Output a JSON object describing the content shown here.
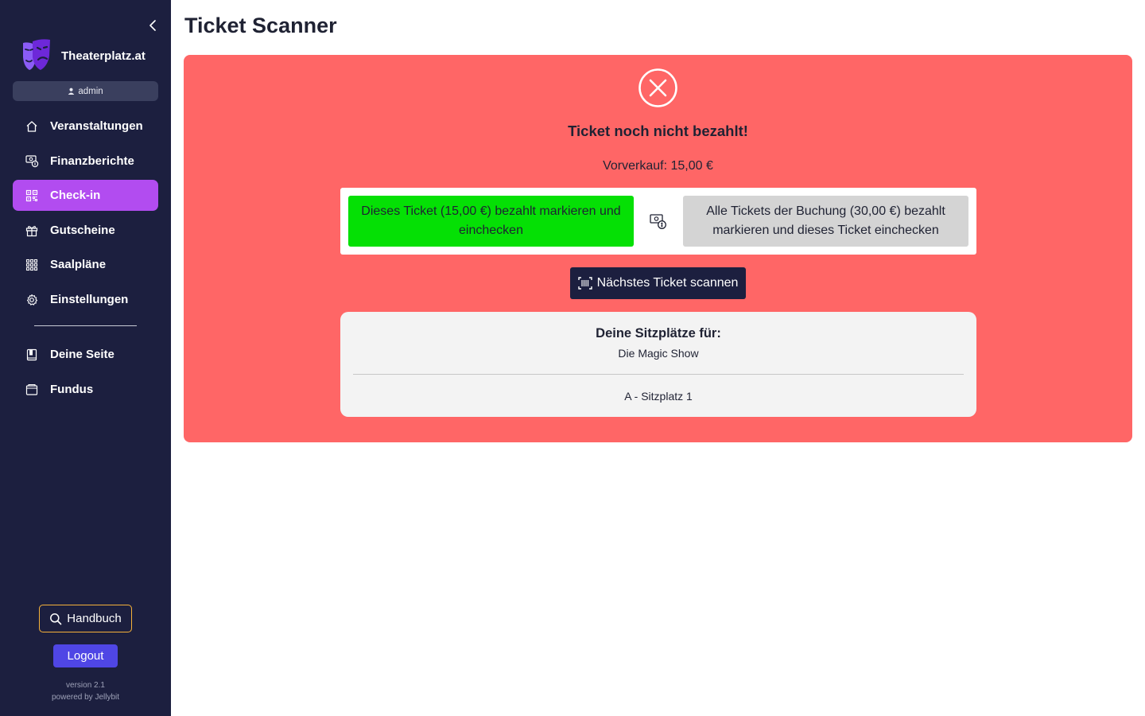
{
  "brand": {
    "name": "Theaterplatz.at"
  },
  "user": {
    "name": "admin"
  },
  "sidebar": {
    "items": [
      {
        "label": "Veranstaltungen",
        "icon": "home-icon",
        "active": false
      },
      {
        "label": "Finanzberichte",
        "icon": "money-icon",
        "active": false
      },
      {
        "label": "Check-in",
        "icon": "qr-code-icon",
        "active": true
      },
      {
        "label": "Gutscheine",
        "icon": "gift-icon",
        "active": false
      },
      {
        "label": "Saalpläne",
        "icon": "grid-icon",
        "active": false
      },
      {
        "label": "Einstellungen",
        "icon": "gear-icon",
        "active": false
      },
      {
        "label": "Deine Seite",
        "icon": "book-icon",
        "active": false
      },
      {
        "label": "Fundus",
        "icon": "box-icon",
        "active": false
      }
    ],
    "handbuch_label": "Handbuch",
    "logout_label": "Logout",
    "version": "version 2.1",
    "powered_by": "powered by Jellybit"
  },
  "main": {
    "title": "Ticket Scanner",
    "status": "Ticket noch nicht bezahlt!",
    "price": "Vorverkauf: 15,00 €",
    "pay_this_label": "Dieses Ticket (15,00 €) bezahlt markieren und einchecken",
    "pay_all_label": "Alle Tickets der Buchung (30,00 €) bezahlt markieren und dieses Ticket einchecken",
    "scan_next_label": "Nächstes Ticket scannen",
    "seats": {
      "title": "Deine Sitzplätze für:",
      "event": "Die Magic Show",
      "seat": "A - Sitzplatz 1"
    }
  },
  "colors": {
    "sidebar_bg": "#1c1f3f",
    "active_item": "#b24cf0",
    "error_panel": "#ff6666",
    "pay_button": "#05e005",
    "secondary_button": "#d4d4d4",
    "logout_button": "#4f46e5",
    "handbuch_border": "#f5b13a"
  }
}
